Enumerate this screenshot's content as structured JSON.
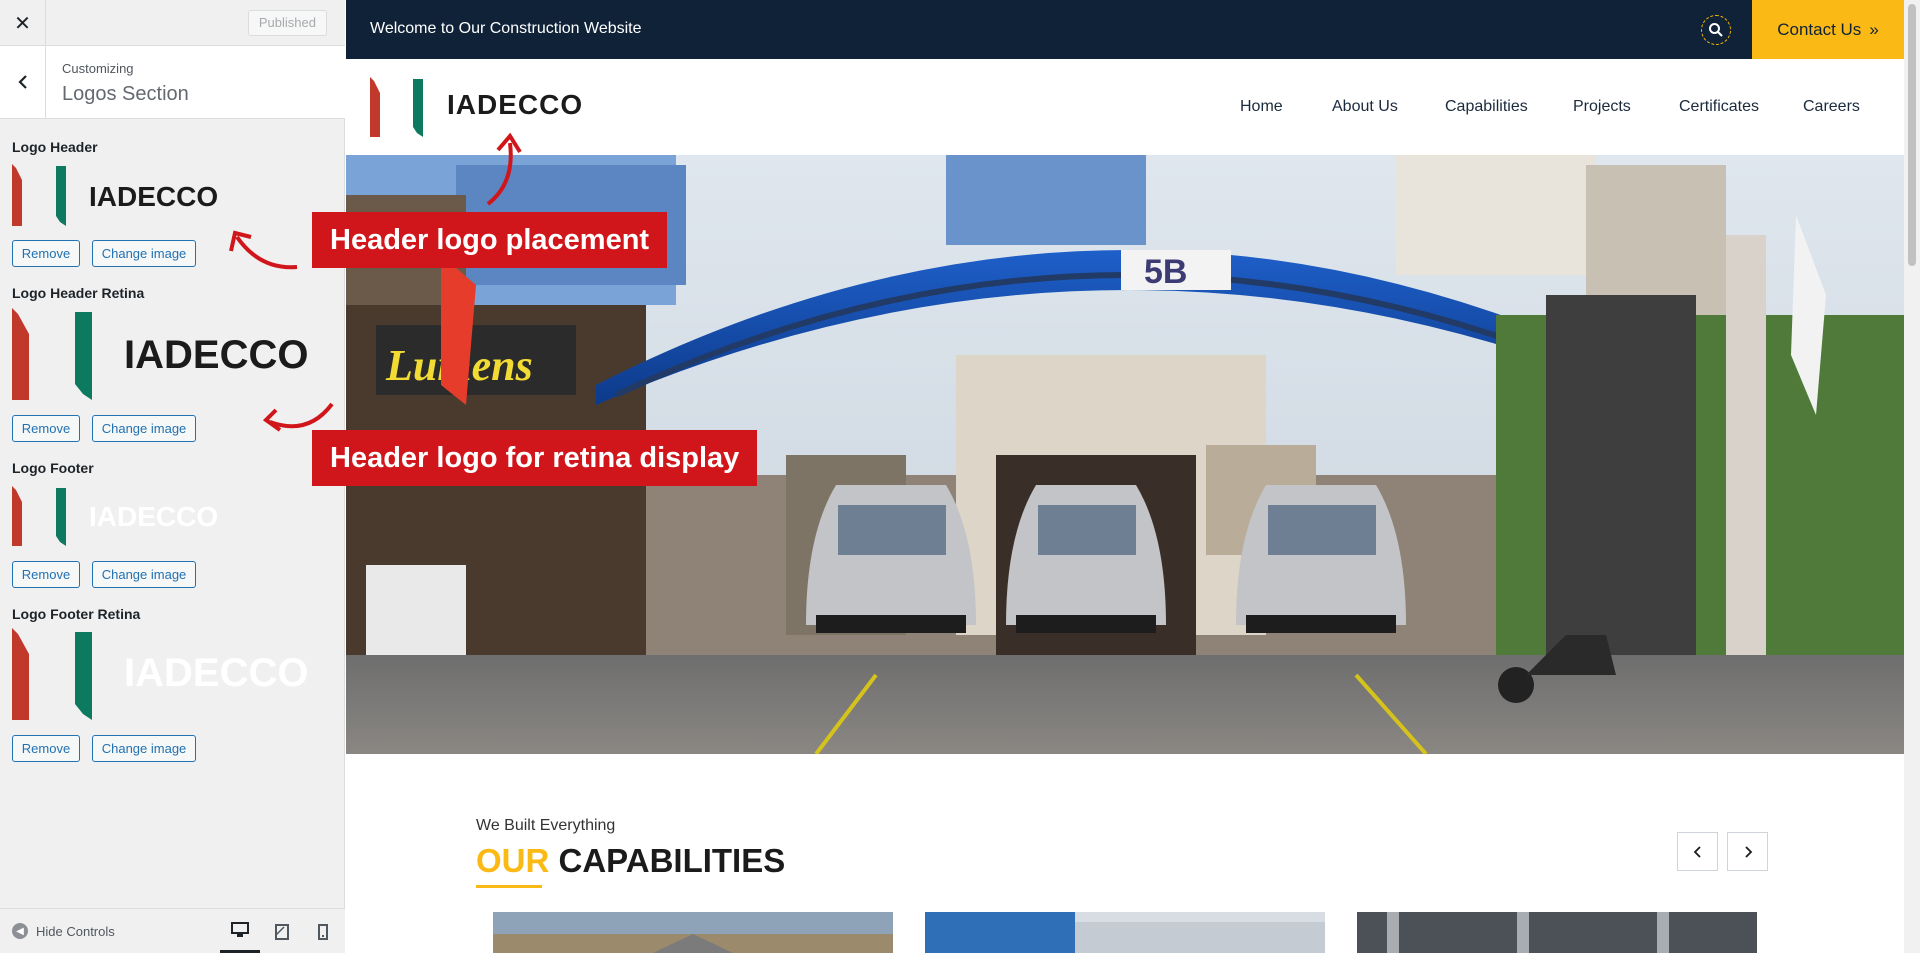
{
  "customizer": {
    "close_icon": "close-icon",
    "published_label": "Published",
    "breadcrumb": "Customizing",
    "section_title": "Logos Section",
    "back_icon": "chevron-left-icon",
    "logo_header_label": "Logo Header",
    "logo_header_retina_label": "Logo Header Retina",
    "logo_footer_label": "Logo Footer",
    "logo_footer_retina_label": "Logo Footer Retina",
    "logo_text": "IADECCO",
    "remove_label": "Remove",
    "change_image_label": "Change image",
    "hide_controls_label": "Hide Controls",
    "devices": [
      "desktop",
      "tablet",
      "mobile"
    ],
    "active_device": "desktop"
  },
  "site": {
    "welcome_text": "Welcome to Our Construction Website",
    "contact_label": "Contact Us",
    "contact_icon": "double-chevron-right-icon",
    "search_icon": "search-icon",
    "logo_text": "IADECCO",
    "nav": [
      "Home",
      "About Us",
      "Capabilities",
      "Projects",
      "Certificates",
      "Careers"
    ],
    "hero_sign_text": "5B",
    "hero_store_sign": "Lumens",
    "capabilities_subtitle": "We Built Everything",
    "capabilities_title_accent": "OUR",
    "capabilities_title_rest": "CAPABILITIES",
    "prev_icon": "chevron-left-icon",
    "next_icon": "chevron-right-icon"
  },
  "annotations": {
    "callout_1": "Header logo placement",
    "callout_2": "Header logo for retina display"
  },
  "colors": {
    "topbar": "#0f2238",
    "accent_yellow": "#fab915",
    "logo_red": "#c0392b",
    "logo_green": "#0d7a5f",
    "callout_red": "#d0161b",
    "wp_blue": "#2271b1"
  }
}
